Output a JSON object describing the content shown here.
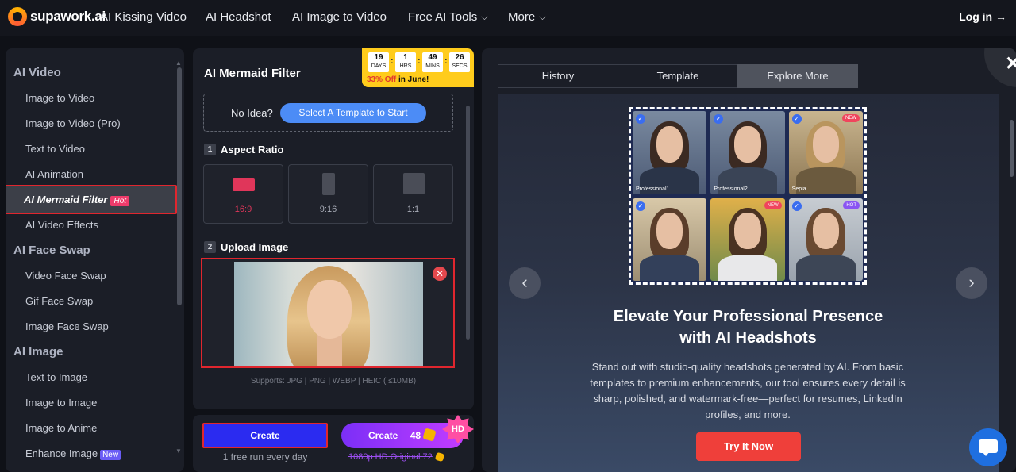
{
  "nav": {
    "logo": "supawork.ai",
    "items": [
      "AI Kissing Video",
      "AI Headshot",
      "AI Image to Video",
      "Free AI Tools",
      "More"
    ],
    "login": "Log in →"
  },
  "sidebar": {
    "sections": [
      {
        "title": "AI Video",
        "items": [
          "Image to Video",
          "Image to Video (Pro)",
          "Text to Video",
          "AI Animation",
          "AI Mermaid Filter",
          "AI Video Effects"
        ]
      },
      {
        "title": "AI Face Swap",
        "items": [
          "Video Face Swap",
          "Gif Face Swap",
          "Image Face Swap"
        ]
      },
      {
        "title": "AI Image",
        "items": [
          "Text to Image",
          "Image to Image",
          "Image to Anime",
          "Enhance Image"
        ]
      }
    ],
    "hot_badge": "Hot",
    "new_badge": "New"
  },
  "panel": {
    "title": "AI Mermaid Filter",
    "timer": {
      "days": "19",
      "days_label": "DAYS",
      "hrs": "1",
      "hrs_label": "HRS",
      "mins": "49",
      "mins_label": "MINS",
      "secs": "26",
      "secs_label": "SECS",
      "offer_pct": "33% Off",
      "offer_rest": " in June!"
    },
    "idea_label": "No Idea?",
    "template_button": "Select A Template to Start",
    "step1_num": "1",
    "step1_label": "Aspect Ratio",
    "ratios": [
      "16:9",
      "9:16",
      "1:1"
    ],
    "step2_num": "2",
    "step2_label": "Upload Image",
    "supports": "Supports: JPG | PNG | WEBP | HEIC ( ≤10MB)"
  },
  "create": {
    "button": "Create",
    "free_run": "1 free run every day",
    "hd_button": "Create",
    "hd_credits": "48",
    "hd_badge": "HD",
    "strike_text": "1080p HD Original 72"
  },
  "right": {
    "tabs": [
      "History",
      "Template",
      "Explore More"
    ],
    "grid_captions": [
      "Professional1",
      "Professional2",
      "Sepia"
    ],
    "tag_new": "NEW",
    "tag_hot": "HOT",
    "headline_1": "Elevate Your Professional Presence",
    "headline_2": "with AI Headshots",
    "description": "Stand out with studio-quality headshots generated by AI. From basic templates to premium enhancements, our tool ensures every detail is sharp, polished, and watermark-free—perfect for resumes, LinkedIn profiles, and more.",
    "try_button": "Try It Now"
  },
  "colors": {
    "accent": "#4c8cf6",
    "selection": "#e0262e",
    "primary_button": "#2b2bf0",
    "cta": "#ef3f3a",
    "timer": "#ffcc1c"
  }
}
